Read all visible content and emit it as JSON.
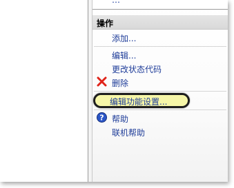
{
  "top_list": {
    "fragment": "…"
  },
  "actions_panel": {
    "header": "操作",
    "items": [
      {
        "label": "添加..."
      },
      {
        "label": "编辑..."
      },
      {
        "label": "更改状态代码"
      },
      {
        "label": "删除",
        "icon": "delete-icon"
      },
      {
        "label": "编辑功能设置..."
      },
      {
        "label": "帮助",
        "icon": "help-icon"
      },
      {
        "label": "联机帮助"
      }
    ]
  },
  "colors": {
    "link": "#1f3d99",
    "delete_icon": "#e0241a",
    "help_icon": "#2b56c7",
    "highlight": "#f6f6a8"
  }
}
